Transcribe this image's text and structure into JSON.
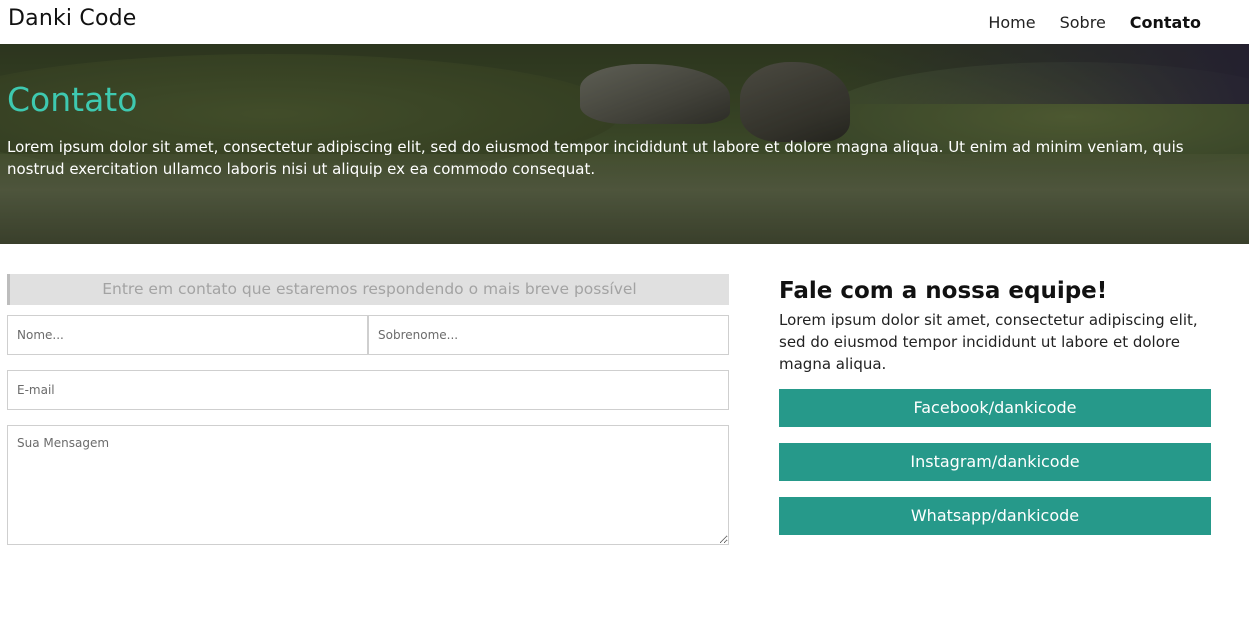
{
  "header": {
    "logo": "Danki Code",
    "nav": [
      {
        "label": "Home"
      },
      {
        "label": "Sobre"
      },
      {
        "label": "Contato"
      }
    ]
  },
  "hero": {
    "title": "Contato",
    "text": "Lorem ipsum dolor sit amet, consectetur adipiscing elit, sed do eiusmod tempor incididunt ut labore et dolore magna aliqua. Ut enim ad minim veniam, quis nostrud exercitation ullamco laboris nisi ut aliquip ex ea commodo consequat."
  },
  "form": {
    "banner": "Entre em contato que estaremos respondendo o mais breve possível",
    "nome_placeholder": "Nome...",
    "sobrenome_placeholder": "Sobrenome...",
    "email_placeholder": "E-mail",
    "mensagem_placeholder": "Sua Mensagem"
  },
  "team": {
    "title": "Fale com a nossa equipe!",
    "text": "Lorem ipsum dolor sit amet, consectetur adipiscing elit, sed do eiusmod tempor incididunt ut labore et dolore magna aliqua.",
    "buttons": [
      {
        "label": "Facebook/dankicode"
      },
      {
        "label": "Instagram/dankicode"
      },
      {
        "label": "Whatsapp/dankicode"
      }
    ]
  },
  "colors": {
    "accent": "#3ec9b0",
    "button": "#26998a",
    "banner_bg": "#e0e0e0"
  }
}
